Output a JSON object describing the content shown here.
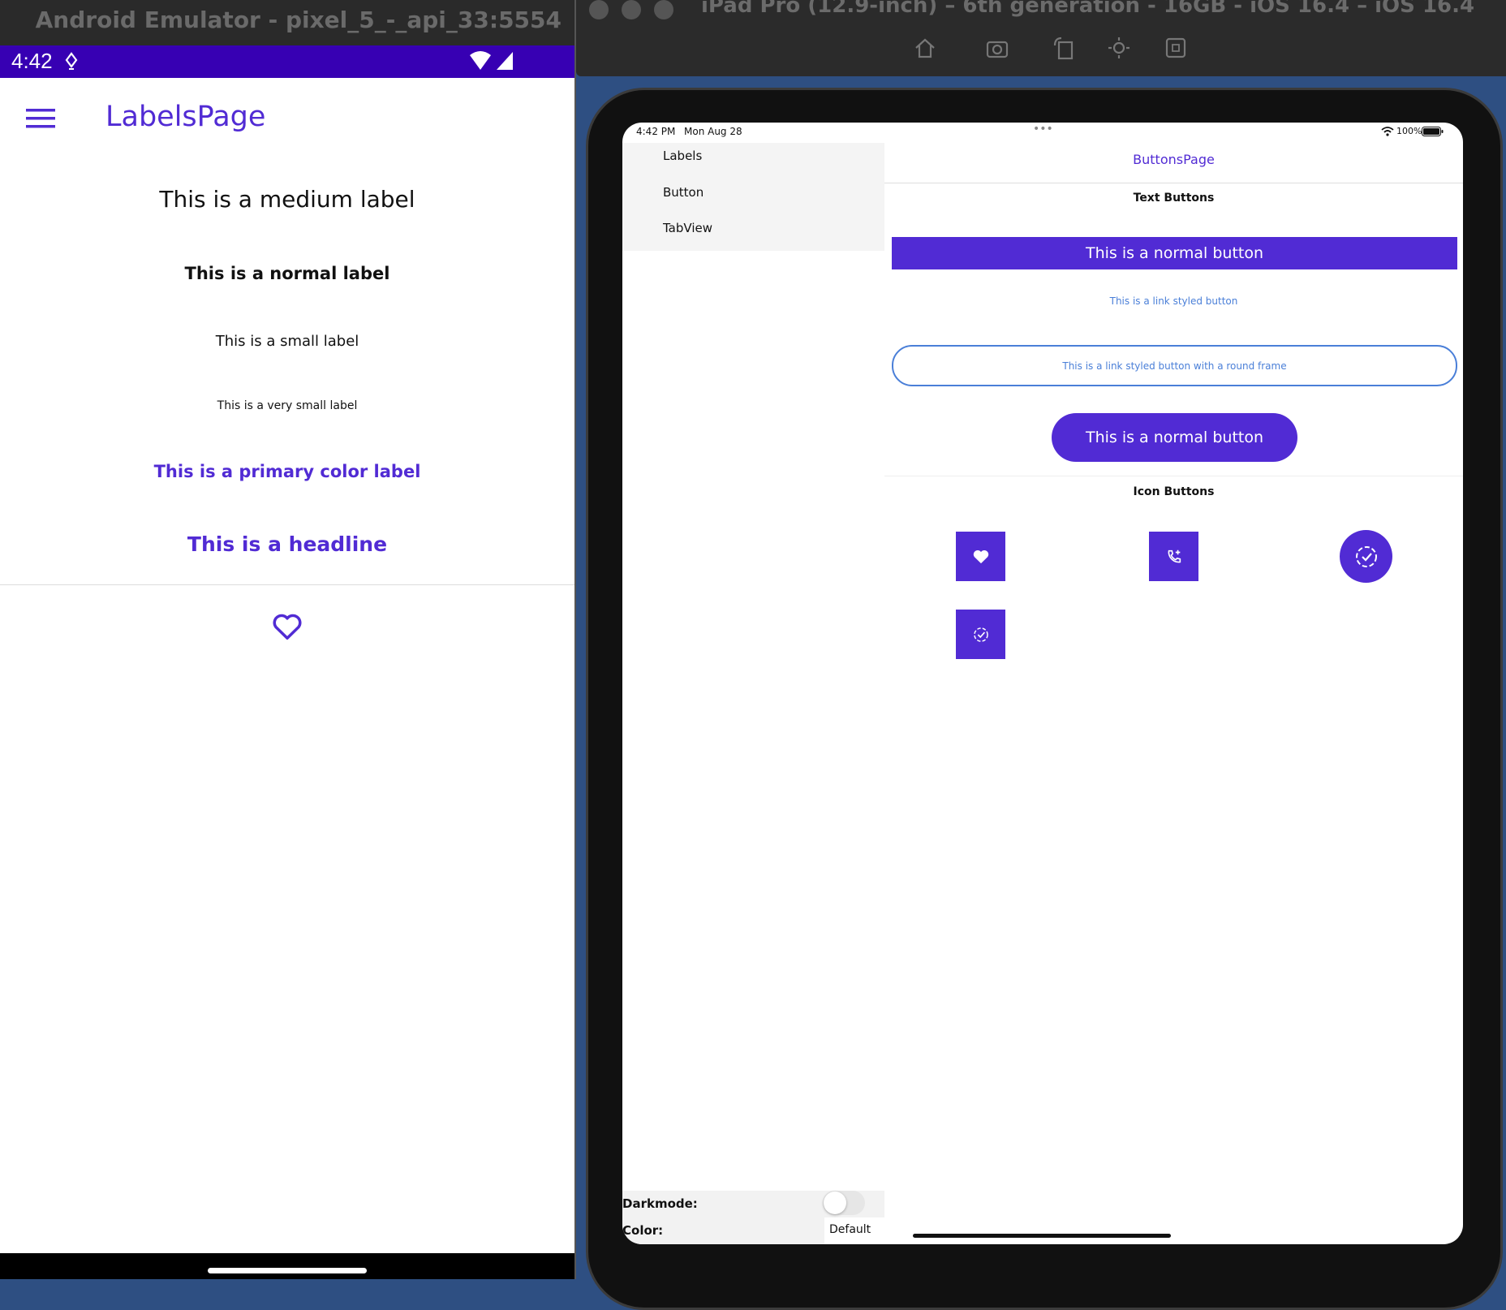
{
  "android": {
    "window_title": "Android Emulator - pixel_5_-_api_33:5554",
    "status_time": "4:42",
    "page_title": "LabelsPage",
    "labels": {
      "medium": "This is a medium label",
      "normal": "This is a normal label",
      "small": "This is a small label",
      "very_small": "This is a very small label",
      "primary": "This is a primary color label",
      "headline": "This is a headline"
    },
    "icons": [
      "menu-icon",
      "heart-outline-icon"
    ]
  },
  "ios": {
    "window_title": "iPad Pro (12.9-inch) – 6th generation - 16GB - iOS 16.4 – iOS 16.4",
    "status_time": "4:42 PM",
    "status_date": "Mon Aug 28",
    "battery": "100%",
    "flyout_items": [
      "Labels",
      "Button",
      "TabView"
    ],
    "darkmode_label": "Darkmode:",
    "color_label": "Color:",
    "color_value": "Default",
    "page_title": "ButtonsPage",
    "text_buttons_header": "Text Buttons",
    "normal_button": "This is a normal button",
    "link_button": "This is a link styled button",
    "link_frame_button": "This is a link styled button with a round frame",
    "rounded_button": "This is a normal button",
    "icon_buttons_header": "Icon Buttons",
    "icons": [
      "heart-icon",
      "phone-add-icon",
      "check-circle-icon",
      "check-circle-icon"
    ]
  },
  "colors": {
    "primary": "#512bd4",
    "android_status": "#3700b3",
    "link": "#4a7fd8"
  }
}
